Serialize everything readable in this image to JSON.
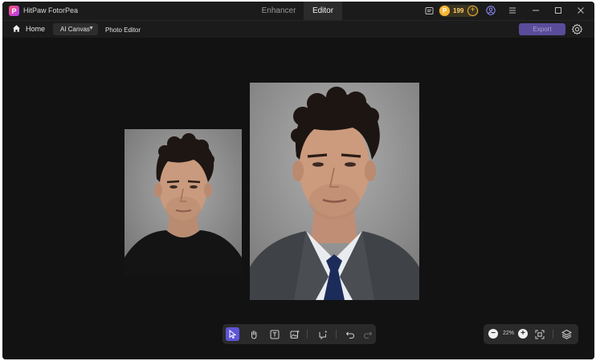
{
  "app": {
    "title": "HitPaw FotorPea",
    "logo_letter": "P",
    "brand_color": "#f7b733"
  },
  "mode_tabs": [
    {
      "label": "Enhancer",
      "active": false
    },
    {
      "label": "Editor",
      "active": true
    }
  ],
  "credits": {
    "count": "199"
  },
  "toolbar": {
    "home_label": "Home",
    "canvas_select": "AI Canvas",
    "breadcrumb": "Photo Editor",
    "export_label": "Export"
  },
  "canvas": {
    "images": [
      {
        "description_icon": "portrait-photo-black-tshirt"
      },
      {
        "description_icon": "portrait-photo-suit-tie"
      }
    ]
  },
  "bottom_tools": [
    {
      "icon": "select-arrow-icon",
      "active": true
    },
    {
      "icon": "hand-icon",
      "active": false
    },
    {
      "icon": "text-icon",
      "active": false
    },
    {
      "icon": "image-add-icon",
      "active": false
    },
    {
      "icon": "ai-chat-icon",
      "active": false
    },
    {
      "icon": "undo-icon",
      "active": false
    },
    {
      "icon": "redo-icon",
      "active": false
    }
  ],
  "zoom": {
    "level": "22%"
  },
  "colors": {
    "accent": "#5d55d6",
    "export_bg": "#5a4c9a",
    "canvas_bg": "#121212"
  }
}
